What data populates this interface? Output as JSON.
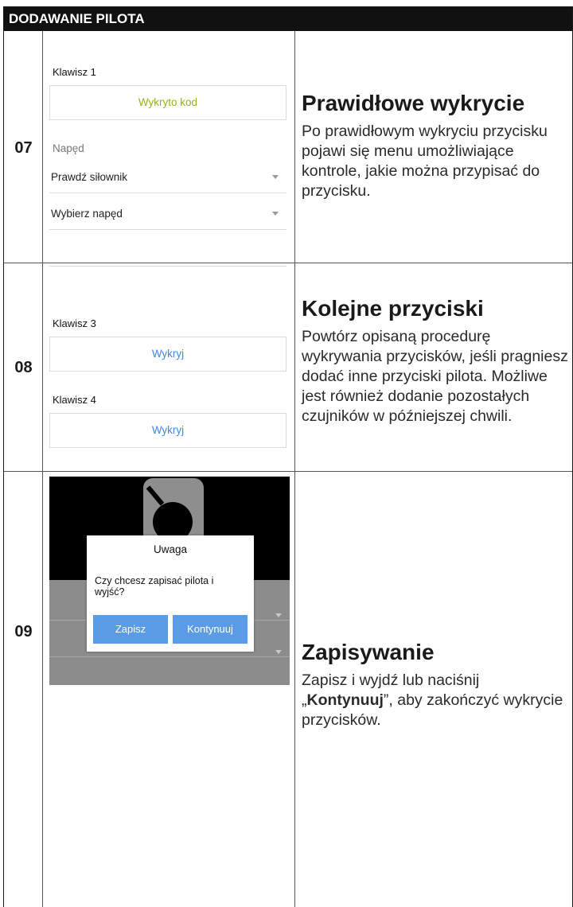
{
  "header": {
    "title": "DODAWANIE PILOTA"
  },
  "steps": [
    {
      "number": "07",
      "title": "Prawidłowe wykrycie",
      "text": "Po prawidłowym wykryciu przycisku pojawi się menu umożliwiające kontrole, jakie można przypisać do przycisku.",
      "screen": {
        "key_label": "Klawisz 1",
        "detected_text": "Wykryto kod",
        "drive_label": "Napęd",
        "select1": "Prawdź siłownik",
        "select2": "Wybierz napęd"
      }
    },
    {
      "number": "08",
      "title": "Kolejne przyciski",
      "text": "Powtórz opisaną procedurę wykrywania przycisków, jeśli pragniesz dodać inne przyciski pilota. Możliwe jest również dodanie pozostałych czujników w późniejszej chwili.",
      "screen": {
        "key3_label": "Klawisz 3",
        "key3_button": "Wykryj",
        "key4_label": "Klawisz 4",
        "key4_button": "Wykryj"
      }
    },
    {
      "number": "09",
      "title": "Zapisywanie",
      "text_before": "Zapisz i wyjdź lub naciśnij „",
      "text_bold": "Kontynuuj",
      "text_after": "”, aby zakończyć wykrycie przycisków.",
      "screen": {
        "dialog_title": "Uwaga",
        "dialog_text": "Czy chcesz zapisać pilota i wyjść?",
        "save_button": "Zapisz",
        "continue_button": "Kontynuuj"
      }
    }
  ],
  "colors": {
    "detected": "#9aaf1c",
    "link_blue": "#3f87e0",
    "dialog_button": "#5a9be6",
    "header_bg": "#111111"
  }
}
